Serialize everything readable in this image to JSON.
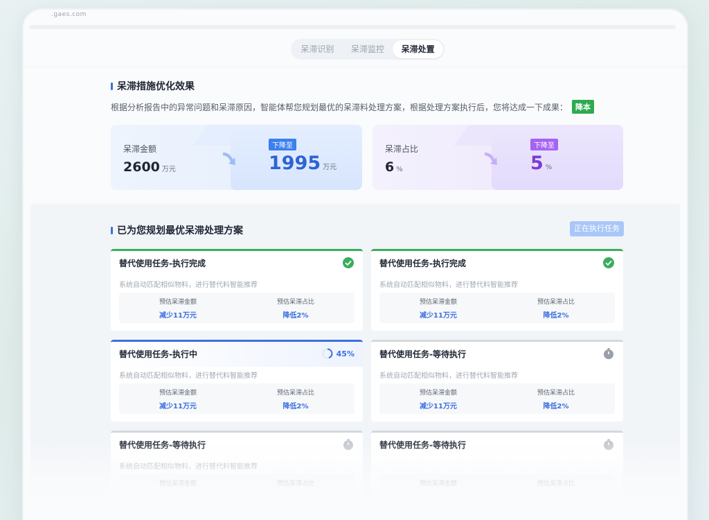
{
  "browser": {
    "url_fragment": ".gaes.com"
  },
  "tabs": [
    {
      "label": "呆滞识别",
      "active": false
    },
    {
      "label": "呆滞监控",
      "active": false
    },
    {
      "label": "呆滞处置",
      "active": true
    }
  ],
  "effect": {
    "title": "呆滞措施优化效果",
    "description": "根据分析报告中的异常问题和呆滞原因，智能体帮您规划最优的呆滞料处理方案，根据处理方案执行后，您将达成一下成果：",
    "result_tag": "降本",
    "amount": {
      "label": "呆滞金额",
      "before": "2600",
      "unit": "万元",
      "badge": "下降至",
      "after": "1995"
    },
    "ratio": {
      "label": "呆滞占比",
      "before": "6",
      "unit": "%",
      "badge": "下降至",
      "after": "5"
    }
  },
  "plans": {
    "title": "已为您规划最优呆滞处理方案",
    "exec_button": "正在执行任务",
    "tasks": [
      {
        "title": "替代使用任务-执行完成",
        "status": "done",
        "desc": "系统自动匹配相似物料，进行替代料智能推荐",
        "m1_label": "预估呆滞金额",
        "m1_value": "减少11万元",
        "m2_label": "预估呆滞占比",
        "m2_value": "降低2%"
      },
      {
        "title": "替代使用任务-执行完成",
        "status": "done",
        "desc": "系统自动匹配相似物料，进行替代料智能推荐",
        "m1_label": "预估呆滞金额",
        "m1_value": "减少11万元",
        "m2_label": "预估呆滞占比",
        "m2_value": "降低2%"
      },
      {
        "title": "替代使用任务-执行中",
        "status": "running",
        "progress": "45%",
        "progress_fraction": 0.45,
        "desc": "系统自动匹配相似物料，进行替代料智能推荐",
        "m1_label": "预估呆滞金额",
        "m1_value": "减少11万元",
        "m2_label": "预估呆滞占比",
        "m2_value": "降低2%"
      },
      {
        "title": "替代使用任务-等待执行",
        "status": "waiting",
        "desc": "系统自动匹配相似物料，进行替代料智能推荐",
        "m1_label": "预估呆滞金额",
        "m1_value": "减少11万元",
        "m2_label": "预估呆滞占比",
        "m2_value": "降低2%"
      },
      {
        "title": "替代使用任务-等待执行",
        "status": "waiting",
        "desc": "系统自动匹配相似物料，进行替代料智能推荐",
        "m1_label": "预估呆滞金额",
        "m1_value": "",
        "m2_label": "预估呆滞占比",
        "m2_value": ""
      },
      {
        "title": "替代使用任务-等待执行",
        "status": "waiting",
        "desc": "",
        "m1_label": "预估呆滞金额",
        "m1_value": "",
        "m2_label": "预估呆滞占比",
        "m2_value": ""
      }
    ]
  },
  "colors": {
    "accent": "#3b6fe0",
    "success": "#3aad5c",
    "purple": "#7c3bd8",
    "waiting": "#b5bac1"
  }
}
